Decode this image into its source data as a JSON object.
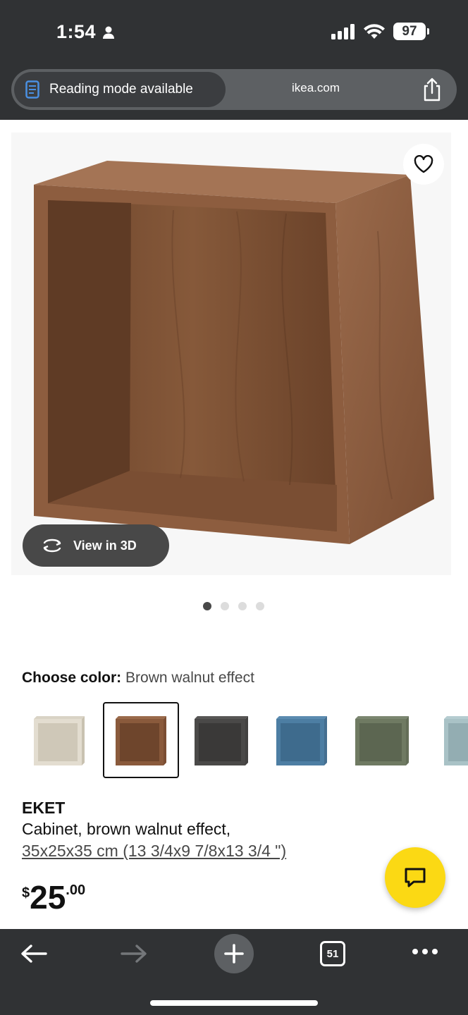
{
  "status_bar": {
    "time": "1:54",
    "battery": "97",
    "icons": [
      "person-icon",
      "signal-icon",
      "wifi-icon",
      "battery-icon"
    ]
  },
  "browser": {
    "reading_mode_label": "Reading mode available",
    "domain": "ikea.com",
    "tab_count": "51"
  },
  "product": {
    "view_3d_label": "View in 3D",
    "image_count": 4,
    "active_image": 0,
    "color_label": "Choose color:",
    "color_value": "Brown walnut effect",
    "swatches": [
      {
        "color": "#e3ddd0",
        "selected": false
      },
      {
        "color": "#8a5a3c",
        "selected": true
      },
      {
        "color": "#4a4948",
        "selected": false
      },
      {
        "color": "#4d7ea3",
        "selected": false
      },
      {
        "color": "#6f7a62",
        "selected": false
      },
      {
        "color": "#a9c2c6",
        "selected": false
      }
    ],
    "name": "EKET",
    "description": "Cabinet, brown walnut effect,",
    "size": "35x25x35 cm (13 3/4x9 7/8x13 3/4 \")",
    "price": {
      "currency": "$",
      "integer": "25",
      "decimal": ".00"
    }
  },
  "colors": {
    "chrome": "#303234",
    "accent_yellow": "#fbd914",
    "wood": "#8a5a3c"
  }
}
